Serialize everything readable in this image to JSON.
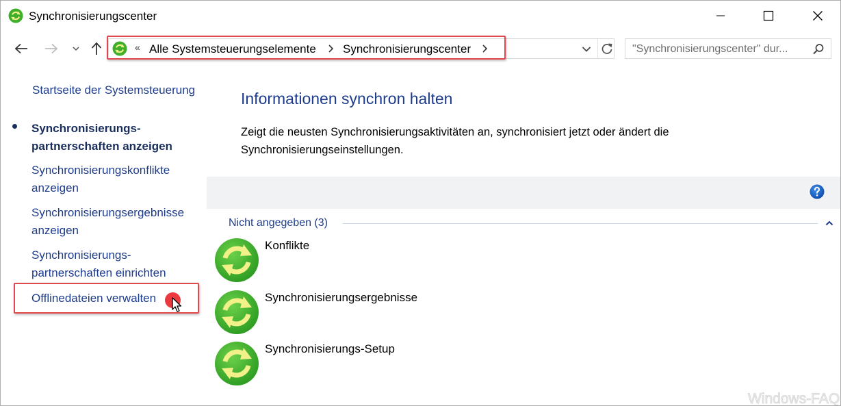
{
  "window": {
    "title": "Synchronisierungscenter"
  },
  "nav": {
    "address_overflow": "«",
    "breadcrumbs": [
      "Alle Systemsteuerungselemente",
      "Synchronisierungscenter"
    ],
    "search_placeholder": "\"Synchronisierungscenter\" dur..."
  },
  "sidebar": {
    "home": "Startseite der Systemsteuerung",
    "items": [
      {
        "label": "Synchronisierungs-\npartnerschaften anzeigen",
        "active": true
      },
      {
        "label": "Synchronisierungskonflikte\nanzeigen",
        "active": false
      },
      {
        "label": "Synchronisierungsergebnisse\nanzeigen",
        "active": false
      },
      {
        "label": "Synchronisierungs-\npartnerschaften einrichten",
        "active": false
      },
      {
        "label": "Offlinedateien verwalten",
        "active": false
      }
    ]
  },
  "main": {
    "heading": "Informationen synchron halten",
    "description": "Zeigt die neusten Synchronisierungsaktivitäten an, synchronisiert jetzt oder ändert die Synchronisierungseinstellungen.",
    "group_header": "Nicht angegeben (3)",
    "items": [
      {
        "label": "Konflikte",
        "icon": "sync-icon"
      },
      {
        "label": "Synchronisierungsergebnisse",
        "icon": "sync-icon"
      },
      {
        "label": "Synchronisierungs-Setup",
        "icon": "sync-icon"
      }
    ]
  },
  "watermark": "Windows-FAQ",
  "colors": {
    "link": "#1e3c8c",
    "highlight": "#e0484d",
    "sync_green": "#3fae2a",
    "sync_arrow": "#f2f088"
  }
}
